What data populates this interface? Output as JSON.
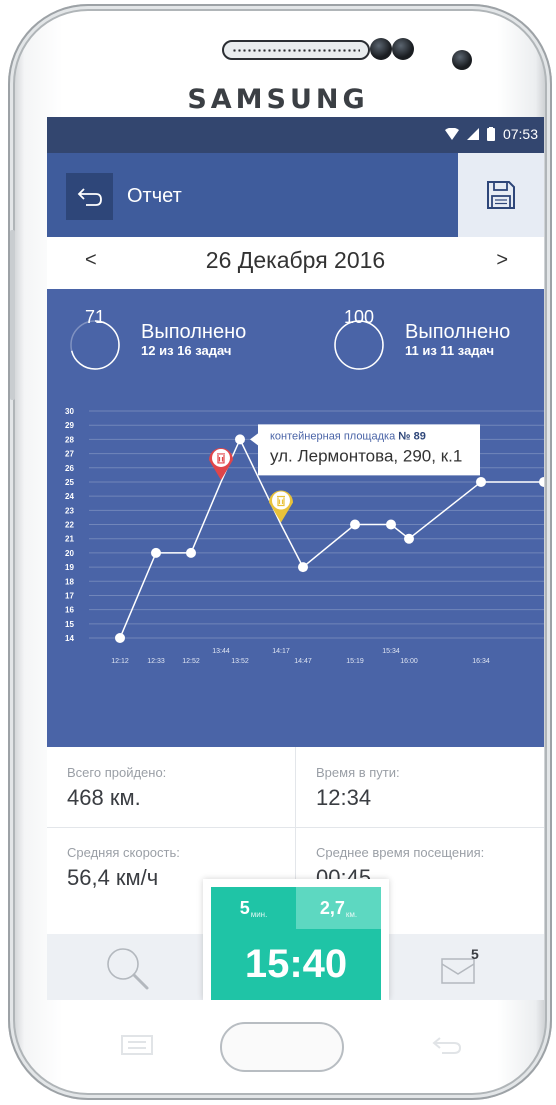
{
  "device": {
    "brand": "SAMSUNG"
  },
  "status_bar": {
    "time": "07:53"
  },
  "app_bar": {
    "title": "Отчет"
  },
  "date_nav": {
    "prev": "<",
    "date": "26 Декабря 2016",
    "next": ">"
  },
  "summary": [
    {
      "value": "71",
      "title": "Выполнено",
      "subtitle": "12 из 16 задач"
    },
    {
      "value": "100",
      "title": "Выполнено",
      "subtitle": "11 из 11 задач"
    }
  ],
  "chart_data": {
    "type": "line",
    "y_ticks": [
      "14",
      "15",
      "16",
      "17",
      "18",
      "19",
      "20",
      "21",
      "22",
      "23",
      "24",
      "25",
      "26",
      "27",
      "28",
      "29",
      "30"
    ],
    "ylim": [
      14,
      30
    ],
    "points": [
      {
        "x": "12:12",
        "y": 14
      },
      {
        "x": "12:33",
        "y": 20
      },
      {
        "x": "12:52",
        "y": 20
      },
      {
        "x": "13:44",
        "y": 25
      },
      {
        "x": "13:52",
        "y": 28
      },
      {
        "x": "14:17",
        "y": 22
      },
      {
        "x": "14:47",
        "y": 19
      },
      {
        "x": "15:19",
        "y": 22
      },
      {
        "x": "15:34",
        "y": 22
      },
      {
        "x": "16:00",
        "y": 21
      },
      {
        "x": "16:34",
        "y": 25
      },
      {
        "x": "",
        "y": 25
      }
    ],
    "x_labels_low": [
      "12:12",
      "12:33",
      "12:52",
      "13:52",
      "14:47",
      "15:19",
      "16:00",
      "16:34"
    ],
    "x_labels_high": [
      "13:44",
      "14:17",
      "15:34"
    ],
    "markers": [
      {
        "x": "13:44",
        "y": 25,
        "color": "#e0454a",
        "icon": "trash-icon"
      },
      {
        "x": "14:17",
        "y": 22,
        "color": "#e8c23a",
        "icon": "trash-icon"
      }
    ],
    "tooltip": {
      "line1_prefix": "контейнерная площадка",
      "line1_number": "№ 89",
      "line2": "ул. Лермонтова, 290, к.1"
    }
  },
  "stats": [
    {
      "label": "Всего пройдено:",
      "value": "468 км."
    },
    {
      "label": "Время в пути:",
      "value": "12:34"
    },
    {
      "label": "Средняя скорость:",
      "value": "56,4 км/ч"
    },
    {
      "label": "Среднее время посещения:",
      "value": "00:45"
    }
  ],
  "timer_widget": {
    "minutes": "5",
    "minutes_unit": "мин.",
    "distance": "2,7",
    "distance_unit": "км.",
    "time": "15:40"
  },
  "bottom_nav": {
    "messages_badge": "5"
  },
  "colors": {
    "primary": "#3f5c9c",
    "statusbar": "#33466f",
    "chart_bg": "#4a64a7",
    "accent": "#1fc4a6",
    "accent_light": "#5dd8c1"
  }
}
